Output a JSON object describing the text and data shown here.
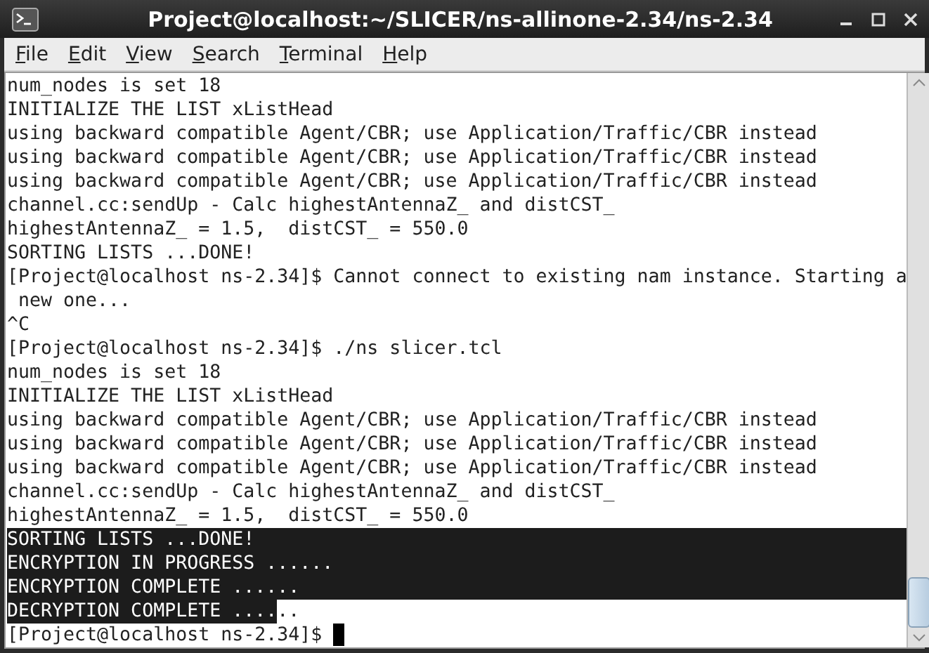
{
  "window": {
    "title": "Project@localhost:~/SLICER/ns-allinone-2.34/ns-2.34"
  },
  "menu": [
    {
      "label": "File"
    },
    {
      "label": "Edit"
    },
    {
      "label": "View"
    },
    {
      "label": "Search"
    },
    {
      "label": "Terminal"
    },
    {
      "label": "Help"
    }
  ],
  "terminal": {
    "lines": [
      {
        "text": "num_nodes is set 18",
        "selected": false
      },
      {
        "text": "INITIALIZE THE LIST xListHead",
        "selected": false
      },
      {
        "text": "using backward compatible Agent/CBR; use Application/Traffic/CBR instead",
        "selected": false
      },
      {
        "text": "using backward compatible Agent/CBR; use Application/Traffic/CBR instead",
        "selected": false
      },
      {
        "text": "using backward compatible Agent/CBR; use Application/Traffic/CBR instead",
        "selected": false
      },
      {
        "text": "channel.cc:sendUp - Calc highestAntennaZ_ and distCST_",
        "selected": false
      },
      {
        "text": "highestAntennaZ_ = 1.5,  distCST_ = 550.0",
        "selected": false
      },
      {
        "text": "SORTING LISTS ...DONE!",
        "selected": false
      },
      {
        "text": "[Project@localhost ns-2.34]$ Cannot connect to existing nam instance. Starting a",
        "selected": false
      },
      {
        "text": " new one...",
        "selected": false
      },
      {
        "text": "^C",
        "selected": false
      },
      {
        "text": "[Project@localhost ns-2.34]$ ./ns slicer.tcl",
        "selected": false
      },
      {
        "text": "num_nodes is set 18",
        "selected": false
      },
      {
        "text": "INITIALIZE THE LIST xListHead",
        "selected": false
      },
      {
        "text": "using backward compatible Agent/CBR; use Application/Traffic/CBR instead",
        "selected": false
      },
      {
        "text": "using backward compatible Agent/CBR; use Application/Traffic/CBR instead",
        "selected": false
      },
      {
        "text": "using backward compatible Agent/CBR; use Application/Traffic/CBR instead",
        "selected": false
      },
      {
        "text": "channel.cc:sendUp - Calc highestAntennaZ_ and distCST_",
        "selected": false
      },
      {
        "text": "highestAntennaZ_ = 1.5,  distCST_ = 550.0",
        "selected": false
      },
      {
        "text": "SORTING LISTS ...DONE!",
        "selected": true
      },
      {
        "text": "ENCRYPTION IN PROGRESS ......",
        "selected": true
      },
      {
        "text": "ENCRYPTION COMPLETE ......",
        "selected": true
      },
      {
        "segments": [
          {
            "text": "DECRYPTION COMPLETE ....",
            "selected": true
          },
          {
            "text": "..",
            "selected": false
          }
        ]
      },
      {
        "text": "[Project@localhost ns-2.34]$ ",
        "selected": false,
        "cursor": true
      }
    ]
  }
}
